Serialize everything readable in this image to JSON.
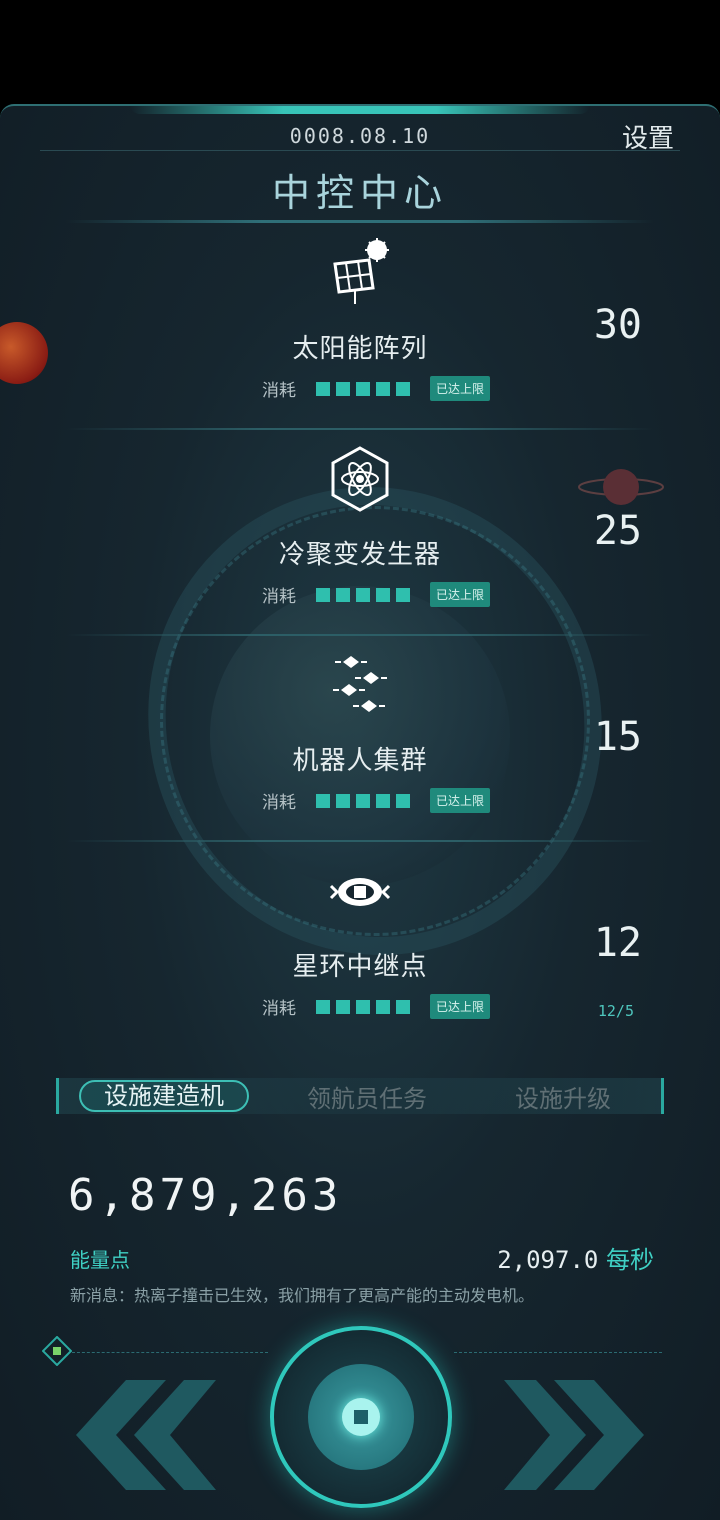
{
  "header": {
    "date": "0008.08.10",
    "settings_label": "设置",
    "title": "中控中心"
  },
  "facilities": [
    {
      "name": "太阳能阵列",
      "icon": "solar-panel-icon",
      "count": "30",
      "sub": "",
      "consume_label": "消耗",
      "levels_filled": 5,
      "levels_total": 5,
      "status": "已达上限"
    },
    {
      "name": "冷聚变发生器",
      "icon": "atom-icon",
      "count": "25",
      "sub": "",
      "consume_label": "消耗",
      "levels_filled": 5,
      "levels_total": 5,
      "status": "已达上限"
    },
    {
      "name": "机器人集群",
      "icon": "robot-swarm-icon",
      "count": "15",
      "sub": "",
      "consume_label": "消耗",
      "levels_filled": 5,
      "levels_total": 5,
      "status": "已达上限"
    },
    {
      "name": "星环中继点",
      "icon": "relay-station-icon",
      "count": "12",
      "sub": "12/5",
      "consume_label": "消耗",
      "levels_filled": 5,
      "levels_total": 5,
      "status": "已达上限"
    }
  ],
  "tabs": [
    {
      "label": "设施建造机",
      "active": true
    },
    {
      "label": "领航员任务",
      "active": false
    },
    {
      "label": "设施升级",
      "active": false
    }
  ],
  "resources": {
    "energy_value": "6,879,263",
    "energy_label": "能量点",
    "rate_value": "2,097.0",
    "rate_unit": "每秒",
    "news": "新消息：热离子撞击已生效，我们拥有了更高产能的主动发电机。"
  },
  "colors": {
    "accent": "#2fbfae",
    "background": "#16262f",
    "title": "#a9d4dc"
  }
}
